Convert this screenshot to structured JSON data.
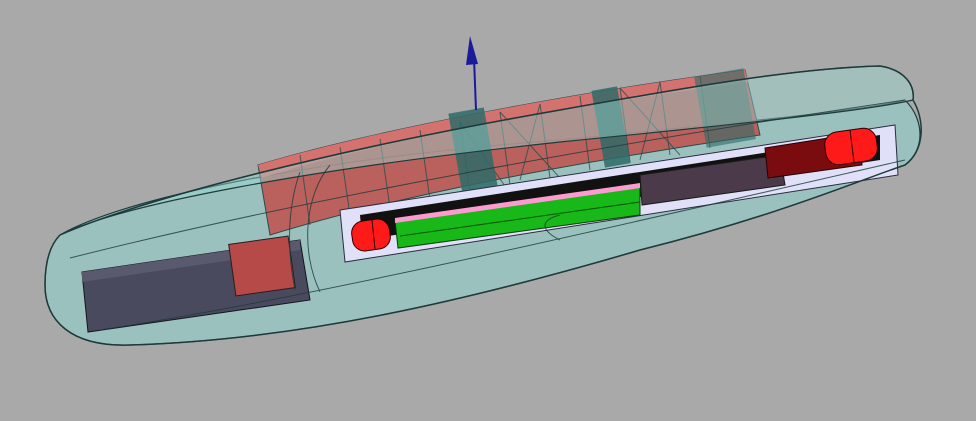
{
  "viewport": {
    "background": "#a9a9a9"
  },
  "scene": {
    "axis_arrow": {
      "icon": "up-arrow-icon",
      "color": "#1a1a9a"
    },
    "shell": {
      "fill": "#8fd6cf",
      "stroke": "#1e3a3a"
    },
    "coil": {
      "fill": "#c0504d",
      "stroke": "#2b4a4a"
    },
    "board": {
      "fill": "#e0e0f8"
    },
    "pcb": {
      "fill": "#18b818"
    },
    "end_caps": {
      "fill": "#ff1a1a"
    },
    "dark_block": {
      "fill": "#4a4a5e"
    }
  }
}
